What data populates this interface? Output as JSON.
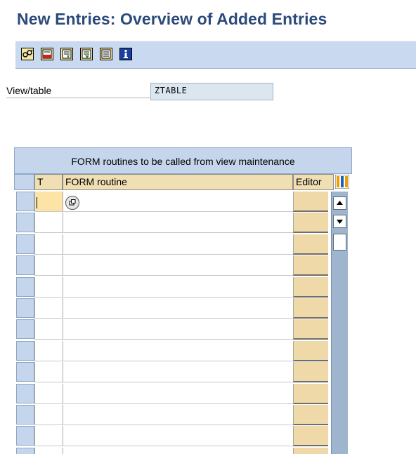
{
  "header": {
    "title": "New Entries: Overview of Added Entries"
  },
  "toolbar": {
    "buttons": [
      {
        "icon": "glasses-icon"
      },
      {
        "icon": "save-icon"
      },
      {
        "icon": "select-all-icon"
      },
      {
        "icon": "select-block-icon"
      },
      {
        "icon": "deselect-all-icon"
      },
      {
        "icon": "info-icon"
      }
    ]
  },
  "form": {
    "view_table_label": "View/table",
    "view_table_value": "ZTABLE"
  },
  "table": {
    "title": "FORM routines to be called from view maintenance",
    "columns": {
      "t": "T",
      "form_routine": "FORM routine",
      "editor": "Editor"
    },
    "rows": 13
  },
  "colors": {
    "toolbar_bg": "#c9d9ef",
    "header_bg": "#f1dfb4",
    "title_color": "#2b4a7a"
  }
}
